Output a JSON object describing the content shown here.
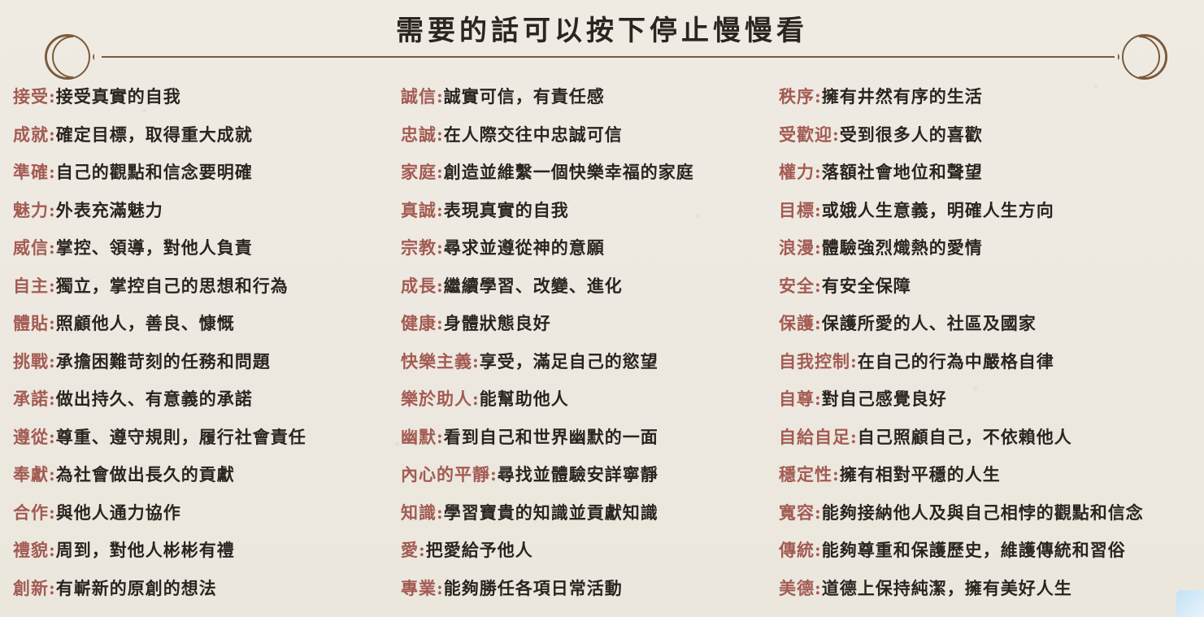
{
  "title": "需要的話可以按下停止慢慢看",
  "colors": {
    "term": "#a35b53",
    "desc": "#2a2520",
    "ornament": "#7a5a3c",
    "background": "#ece8df"
  },
  "icons": {
    "left_ornament": "crescent-moon-icon",
    "right_ornament": "crescent-moon-icon",
    "corner": "logo-badge-icon"
  },
  "columns": [
    [
      {
        "term": "接受",
        "desc": "接受真實的自我"
      },
      {
        "term": "成就",
        "desc": "確定目標，取得重大成就"
      },
      {
        "term": "準確",
        "desc": "自己的觀點和信念要明確"
      },
      {
        "term": "魅力",
        "desc": "外表充滿魅力"
      },
      {
        "term": "威信",
        "desc": "掌控、領導，對他人負責"
      },
      {
        "term": "自主",
        "desc": "獨立，掌控自己的思想和行為"
      },
      {
        "term": "體貼",
        "desc": "照顧他人，善良、慷慨"
      },
      {
        "term": "挑戰",
        "desc": "承擔困難苛刻的任務和問題"
      },
      {
        "term": "承諾",
        "desc": "做出持久、有意義的承諾"
      },
      {
        "term": "遵從",
        "desc": "尊重、遵守規則，履行社會責任"
      },
      {
        "term": "奉獻",
        "desc": "為社會做出長久的貢獻"
      },
      {
        "term": "合作",
        "desc": "與他人通力協作"
      },
      {
        "term": "禮貌",
        "desc": "周到，對他人彬彬有禮"
      },
      {
        "term": "創新",
        "desc": "有嶄新的原創的想法"
      }
    ],
    [
      {
        "term": "誠信",
        "desc": "誠實可信，有責任感"
      },
      {
        "term": "忠誠",
        "desc": "在人際交往中忠誠可信"
      },
      {
        "term": "家庭",
        "desc": "創造並維繫一個快樂幸福的家庭"
      },
      {
        "term": "真誠",
        "desc": "表現真實的自我"
      },
      {
        "term": "宗教",
        "desc": "尋求並遵從神的意願"
      },
      {
        "term": "成長",
        "desc": "繼續學習、改變、進化"
      },
      {
        "term": "健康",
        "desc": "身體狀態良好"
      },
      {
        "term": "快樂主義",
        "desc": "享受，滿足自己的慾望"
      },
      {
        "term": "樂於助人",
        "desc": "能幫助他人"
      },
      {
        "term": "幽默",
        "desc": "看到自己和世界幽默的一面"
      },
      {
        "term": "內心的平靜",
        "desc": "尋找並體驗安詳寧靜"
      },
      {
        "term": "知識",
        "desc": "學習寶貴的知識並貢獻知識"
      },
      {
        "term": "愛",
        "desc": "把愛給予他人"
      },
      {
        "term": "專業",
        "desc": "能夠勝任各項日常活動"
      }
    ],
    [
      {
        "term": "秩序",
        "desc": "擁有井然有序的生活"
      },
      {
        "term": "受歡迎",
        "desc": "受到很多人的喜歡"
      },
      {
        "term": "權力",
        "desc": "落額社會地位和聲望"
      },
      {
        "term": "目標",
        "desc": "或娥人生意義，明確人生方向"
      },
      {
        "term": "浪漫",
        "desc": "體驗強烈熾熱的愛情"
      },
      {
        "term": "安全",
        "desc": "有安全保障"
      },
      {
        "term": "保護",
        "desc": "保護所愛的人、社區及國家"
      },
      {
        "term": "自我控制",
        "desc": "在自己的行為中嚴格自律"
      },
      {
        "term": "自尊",
        "desc": "對自己感覺良好"
      },
      {
        "term": "自給自足",
        "desc": "自己照顧自己，不依賴他人"
      },
      {
        "term": "穩定性",
        "desc": "擁有相對平穩的人生"
      },
      {
        "term": "寬容",
        "desc": "能夠接納他人及與自己相悖的觀點和信念"
      },
      {
        "term": "傳統",
        "desc": "能夠尊重和保護歷史，維護傳統和習俗"
      },
      {
        "term": "美德",
        "desc": "道德上保持純潔，擁有美好人生"
      }
    ]
  ]
}
